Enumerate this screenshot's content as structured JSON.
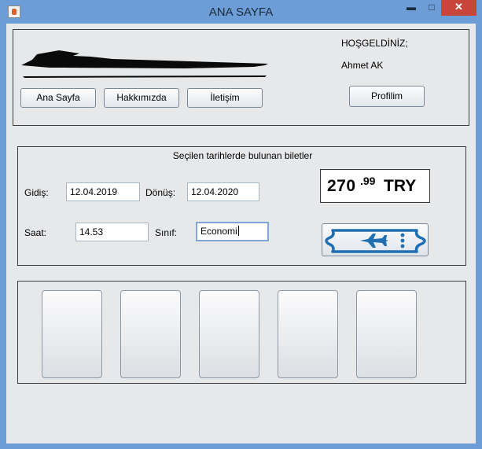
{
  "window": {
    "title": "ANA SAYFA",
    "controls": {
      "minimize": "▬",
      "maximize": "□",
      "close": "✕"
    }
  },
  "header": {
    "welcome_label": "HOŞGELDİNİZ;",
    "user_name": "Ahmet AK",
    "nav": [
      {
        "label": "Ana Sayfa"
      },
      {
        "label": "Hakkımızda"
      },
      {
        "label": "İletişim"
      }
    ],
    "profile_button": "Profilim",
    "logo_icon": "airplane-silhouette-icon"
  },
  "search": {
    "title": "Seçilen tarihlerde bulunan biletler",
    "departure_label": "Gidiş:",
    "departure_value": "12.04.2019",
    "return_label": "Dönüş:",
    "return_value": "12.04.2020",
    "time_label": "Saat:",
    "time_value": "14.53",
    "class_label": "Sınıf:",
    "class_value": "Economi",
    "price_whole": "270",
    "price_fraction": ".99",
    "price_currency": "TRY",
    "ticket_icon": "plane-ticket-icon",
    "ticket_color": "#1f6fb2"
  },
  "results": {
    "cards": [
      {
        "name": "result-card"
      },
      {
        "name": "result-card"
      },
      {
        "name": "result-card"
      },
      {
        "name": "result-card"
      },
      {
        "name": "result-card"
      }
    ]
  }
}
